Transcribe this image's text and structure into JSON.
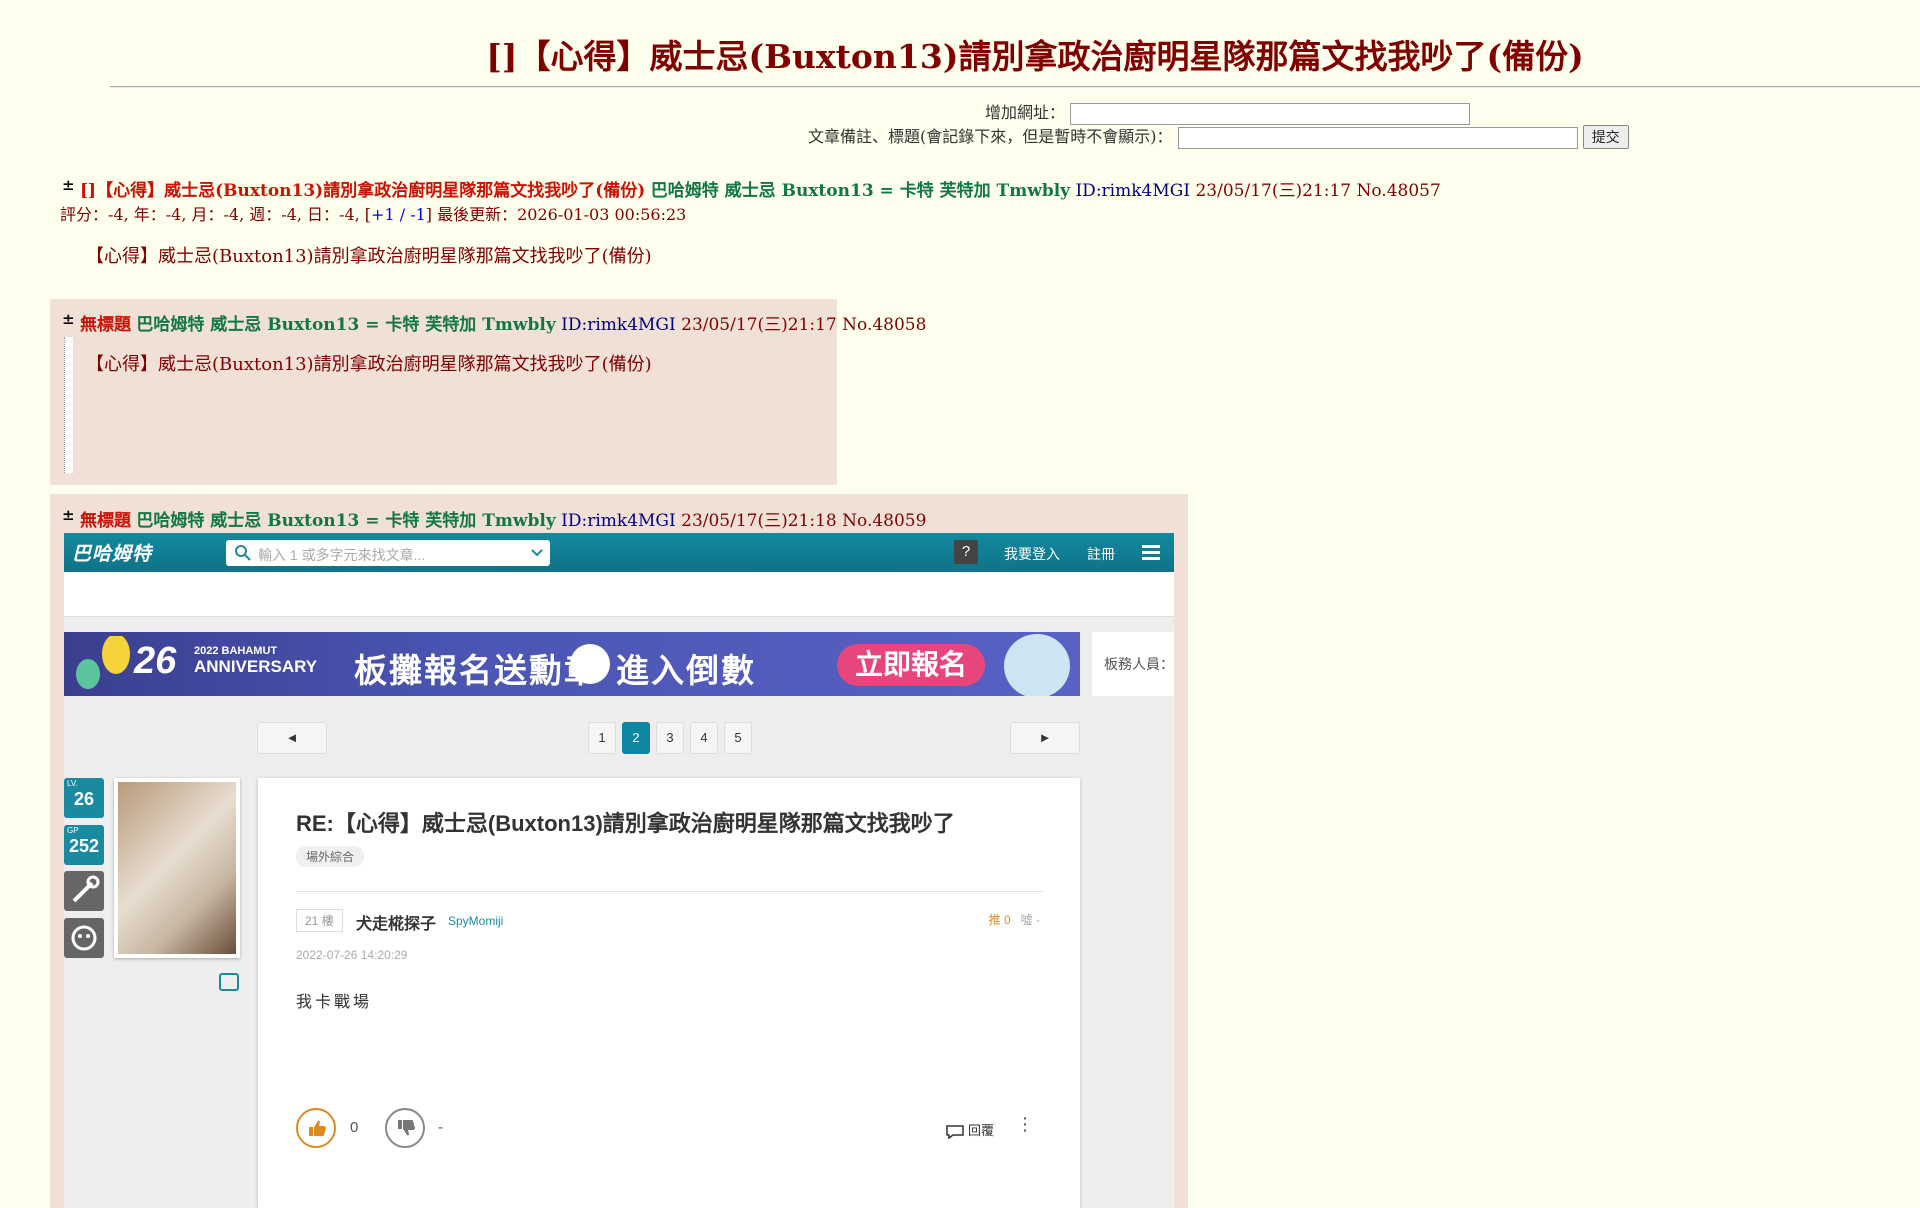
{
  "page": {
    "title": "[]【心得】威士忌(Buxton13)請別拿政治廚明星隊那篇文找我吵了(備份)"
  },
  "form": {
    "add_url_label": "增加網址：",
    "note_label": "文章備註、標題(會記錄下來，但是暫時不會顯示)：",
    "submit_label": "提交"
  },
  "op": {
    "toggle": "±",
    "subject": "[]【心得】威士忌(Buxton13)請別拿政治廚明星隊那篇文找我吵了(備份)",
    "name": "巴哈姆特 威士忌 Buxton13 = 卡特 芙特加 Tmwbly",
    "id_label": "ID:",
    "id": "rimk4MGI",
    "datetime": "23/05/17(三)21:17 No.48057",
    "score_prefix": "評分：-4, 年：-4, 月：-4, 週：-4, 日：-4, [",
    "plus": "+1",
    "slash": " / ",
    "minus": "-1",
    "score_suffix": "] 最後更新：2026-01-03 00:56:23",
    "body": "【心得】威士忌(Buxton13)請別拿政治廚明星隊那篇文找我吵了(備份)"
  },
  "reply1": {
    "toggle": "±",
    "subject": "無標題",
    "name": "巴哈姆特 威士忌 Buxton13 = 卡特 芙特加 Tmwbly",
    "id_label": "ID:",
    "id": "rimk4MGI",
    "datetime": "23/05/17(三)21:17 No.48058",
    "body": "【心得】威士忌(Buxton13)請別拿政治廚明星隊那篇文找我吵了(備份)"
  },
  "reply2": {
    "toggle": "±",
    "subject": "無標題",
    "name": "巴哈姆特 威士忌 Buxton13 = 卡特 芙特加 Tmwbly",
    "id_label": "ID:",
    "id": "rimk4MGI",
    "datetime": "23/05/17(三)21:18 No.48059"
  },
  "screenshot": {
    "logo": "巴哈姆特",
    "search_placeholder": "輸入 1 或多字元來找文章...",
    "login": "我要登入",
    "register": "註冊",
    "banner_num": "26",
    "banner_year": "2022 BAHAMUT",
    "banner_anniv": "ANNIVERSARY",
    "banner_text1": "板攤報名送勳章",
    "banner_text2": "進入倒數",
    "banner_cta": "立即報名",
    "moderators": "板務人員：",
    "prev": "◄",
    "next": "►",
    "pages": [
      "1",
      "2",
      "3",
      "4",
      "5"
    ],
    "lv_label": "LV.",
    "lv": "26",
    "gp_label": "GP",
    "gp": "252",
    "post_title": "RE:【心得】威士忌(Buxton13)請別拿政治廚明星隊那篇文找我吵了",
    "tag": "場外綜合",
    "floor": "21 樓",
    "author": "犬走椛探子",
    "author_id": "SpyMomiji",
    "push": "推 0",
    "boo": "噓 -",
    "date": "2022-07-26 14:20:29",
    "content": "我卡戰場",
    "like_count": "0",
    "dislike_count": "-",
    "reply": "回覆",
    "colors": {
      "brand": "#117e96",
      "accent": "#e08a1e"
    }
  }
}
